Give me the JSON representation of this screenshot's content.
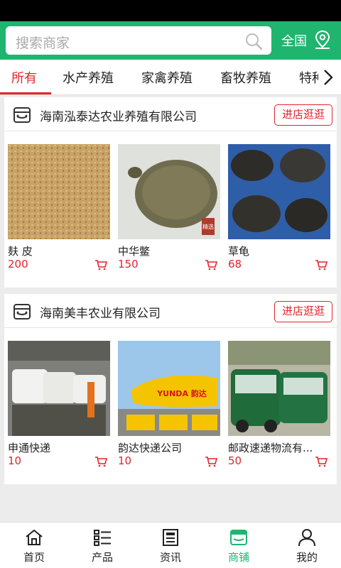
{
  "search": {
    "placeholder": "搜索商家",
    "region": "全国"
  },
  "tabs": [
    "所有",
    "水产养殖",
    "家禽养殖",
    "畜牧养殖",
    "特种"
  ],
  "shops": [
    {
      "name": "海南泓泰达农业养殖有限公司",
      "enter_label": "进店逛逛",
      "products": [
        {
          "name": "麸 皮",
          "price": "200"
        },
        {
          "name": "中华鳖",
          "price": "150"
        },
        {
          "name": "草龟",
          "price": "68"
        }
      ]
    },
    {
      "name": "海南美丰农业有限公司",
      "enter_label": "进店逛逛",
      "products": [
        {
          "name": "申通快递",
          "price": "10"
        },
        {
          "name": "韵达快递公司",
          "price": "10"
        },
        {
          "name": "邮政速递物流有...",
          "price": "50"
        }
      ]
    }
  ],
  "image_text": {
    "yunda": "YUNDA 韵达",
    "stamp": "精选"
  },
  "bottom_nav": [
    {
      "label": "首页",
      "icon": "home-icon"
    },
    {
      "label": "产品",
      "icon": "list-icon"
    },
    {
      "label": "资讯",
      "icon": "news-icon"
    },
    {
      "label": "商铺",
      "icon": "store-icon"
    },
    {
      "label": "我的",
      "icon": "user-icon"
    }
  ],
  "colors": {
    "primary": "#1fb56f",
    "accent": "#e1242b"
  }
}
